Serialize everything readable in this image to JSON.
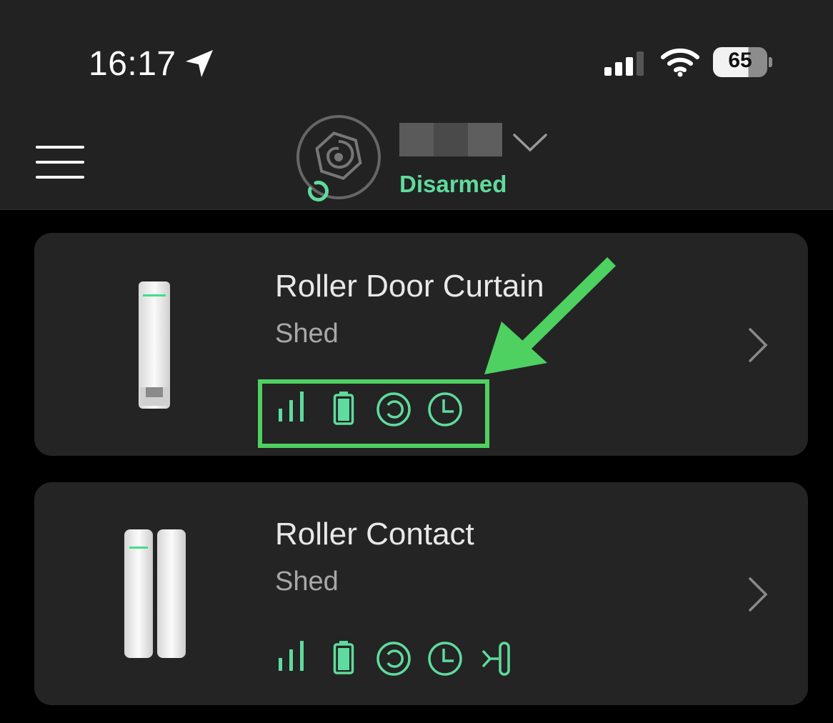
{
  "status_bar": {
    "time": "16:17",
    "battery_level": "65"
  },
  "header": {
    "hub_status": "Disarmed",
    "status_color": "#5fdb9d",
    "redaction_colors": [
      "#5a5a5a",
      "#4a4a4a",
      "#5e5e5e"
    ]
  },
  "devices": [
    {
      "name": "Roller Door Curtain",
      "room": "Shed",
      "status_icons": [
        "signal-strength-icon",
        "battery-icon",
        "sync-icon",
        "delay-clock-icon"
      ]
    },
    {
      "name": "Roller Contact",
      "room": "Shed",
      "status_icons": [
        "signal-strength-icon",
        "battery-icon",
        "sync-icon",
        "delay-clock-icon",
        "contact-sensor-icon"
      ]
    }
  ],
  "annotation": {
    "color": "#4ed160",
    "highlighted": "status-icon-row of Roller Door Curtain"
  },
  "colors": {
    "accent": "#5fdb9d",
    "card_bg": "#242424",
    "header_bg": "#222222"
  }
}
